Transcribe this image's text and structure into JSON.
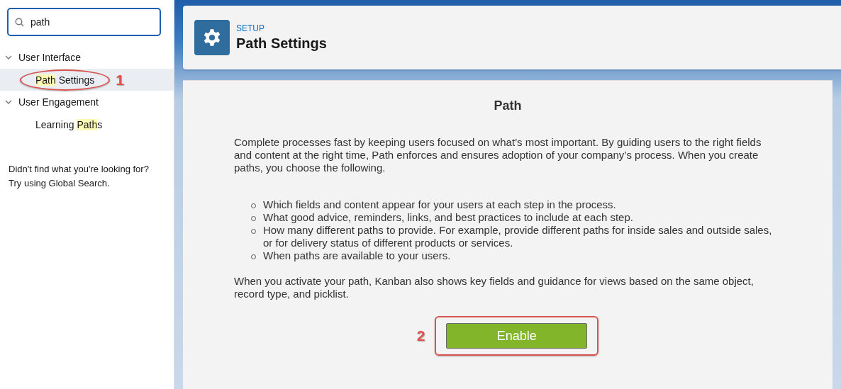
{
  "sidebar": {
    "search": {
      "value": "path"
    },
    "groups": [
      {
        "label": "User Interface",
        "expanded": true,
        "children": [
          {
            "parts": [
              {
                "text": "Path",
                "highlight": true
              },
              {
                "text": " Settings",
                "highlight": false
              }
            ],
            "selected": true,
            "callout": "1"
          }
        ]
      },
      {
        "label": "User Engagement",
        "expanded": true,
        "children": [
          {
            "parts": [
              {
                "text": "Learning ",
                "highlight": false
              },
              {
                "text": "Path",
                "highlight": true
              },
              {
                "text": "s",
                "highlight": false
              }
            ],
            "selected": false
          }
        ]
      }
    ],
    "help": [
      "Didn't find what you're looking for?",
      "Try using Global Search."
    ]
  },
  "header": {
    "eyebrow": "SETUP",
    "title": "Path Settings"
  },
  "content": {
    "title": "Path",
    "intro": "Complete processes fast by keeping users focused on what’s most important. By guiding users to the right fields and content at the right time, Path enforces and ensures adoption of your company’s process. When you create paths, you choose the following.",
    "bullets": [
      "Which fields and content appear for your users at each step in the process.",
      "What good advice, reminders, links, and best practices to include at each step.",
      "How many different paths to provide. For example, provide different paths for inside sales and outside sales, or for delivery status of different products or services.",
      "When paths are available to your users."
    ],
    "outro": "When you activate your path, Kanban also shows key fields and guidance for views based on the same object, record type, and picklist.",
    "button": {
      "label": "Enable",
      "callout": "2"
    }
  }
}
